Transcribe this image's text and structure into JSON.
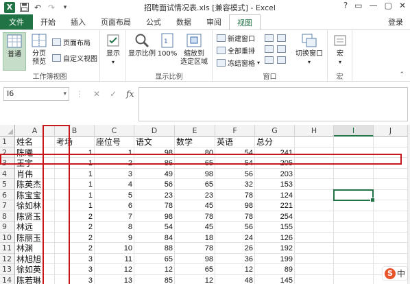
{
  "window": {
    "title": "招聘面试情况表.xls [兼容模式] - Excel",
    "controls": [
      "?",
      "▭",
      "—",
      "▢",
      "✕"
    ]
  },
  "qat": {
    "logo": "X"
  },
  "tabs": [
    "文件",
    "开始",
    "插入",
    "页面布局",
    "公式",
    "数据",
    "审阅",
    "视图"
  ],
  "login": "登录",
  "ribbon": {
    "workbook_views": {
      "normal": "普通",
      "page_break": "分页\n预览",
      "page_layout": "页面布局",
      "custom_views": "自定义视图",
      "label": "工作簿视图"
    },
    "show": {
      "label": "显示",
      "dropdown": "▾"
    },
    "zoom": {
      "zoom": "显示比例",
      "hundred": "100%",
      "to_selection": "缩放到\n选定区域",
      "label": "显示比例"
    },
    "window": {
      "new_window": "新建窗口",
      "arrange_all": "全部重排",
      "freeze": "冻结窗格",
      "switch": "切换窗口",
      "label": "窗口"
    },
    "macros": {
      "macro": "宏",
      "label": "宏"
    }
  },
  "formula_bar": {
    "name_box": "I6",
    "cancel": "✕",
    "enter": "✓",
    "fx": "fx",
    "value": ""
  },
  "columns": [
    "A",
    "B",
    "C",
    "D",
    "E",
    "F",
    "G",
    "H",
    "I",
    "J"
  ],
  "selected_column": "I",
  "rows": [
    {
      "n": "1",
      "A": "姓名",
      "B": "考场",
      "C": "座位号",
      "D": "语文",
      "E": "数学",
      "F": "英语",
      "G": "总分"
    },
    {
      "n": "2",
      "A": "陈曦",
      "B": "1",
      "C": "1",
      "D": "98",
      "E": "80",
      "F": "54",
      "G": "241"
    },
    {
      "n": "3",
      "A": "王宇",
      "B": "1",
      "C": "2",
      "D": "86",
      "E": "65",
      "F": "54",
      "G": "205"
    },
    {
      "n": "4",
      "A": "肖伟",
      "B": "1",
      "C": "3",
      "D": "49",
      "E": "98",
      "F": "56",
      "G": "203"
    },
    {
      "n": "5",
      "A": "陈英杰",
      "B": "1",
      "C": "4",
      "D": "56",
      "E": "65",
      "F": "32",
      "G": "153"
    },
    {
      "n": "6",
      "A": "陈宝宝",
      "B": "1",
      "C": "5",
      "D": "23",
      "E": "23",
      "F": "78",
      "G": "124"
    },
    {
      "n": "7",
      "A": "徐如林",
      "B": "1",
      "C": "6",
      "D": "78",
      "E": "45",
      "F": "98",
      "G": "221"
    },
    {
      "n": "8",
      "A": "陈贤玉",
      "B": "2",
      "C": "7",
      "D": "98",
      "E": "78",
      "F": "78",
      "G": "254"
    },
    {
      "n": "9",
      "A": "林远",
      "B": "2",
      "C": "8",
      "D": "54",
      "E": "45",
      "F": "56",
      "G": "155"
    },
    {
      "n": "10",
      "A": "陈丽玉",
      "B": "2",
      "C": "9",
      "D": "84",
      "E": "18",
      "F": "24",
      "G": "126"
    },
    {
      "n": "11",
      "A": "林渊",
      "B": "2",
      "C": "10",
      "D": "88",
      "E": "78",
      "F": "26",
      "G": "192"
    },
    {
      "n": "12",
      "A": "林旭旭",
      "B": "3",
      "C": "11",
      "D": "65",
      "E": "98",
      "F": "36",
      "G": "199"
    },
    {
      "n": "13",
      "A": "徐如英",
      "B": "3",
      "C": "12",
      "D": "12",
      "E": "65",
      "F": "12",
      "G": "89"
    },
    {
      "n": "14",
      "A": "陈若琳",
      "B": "3",
      "C": "13",
      "D": "85",
      "E": "12",
      "F": "48",
      "G": "145"
    }
  ],
  "ime": {
    "logo": "S",
    "mode": "中"
  },
  "colors": {
    "excel_green": "#217346",
    "annotation_red": "#c8161d"
  }
}
